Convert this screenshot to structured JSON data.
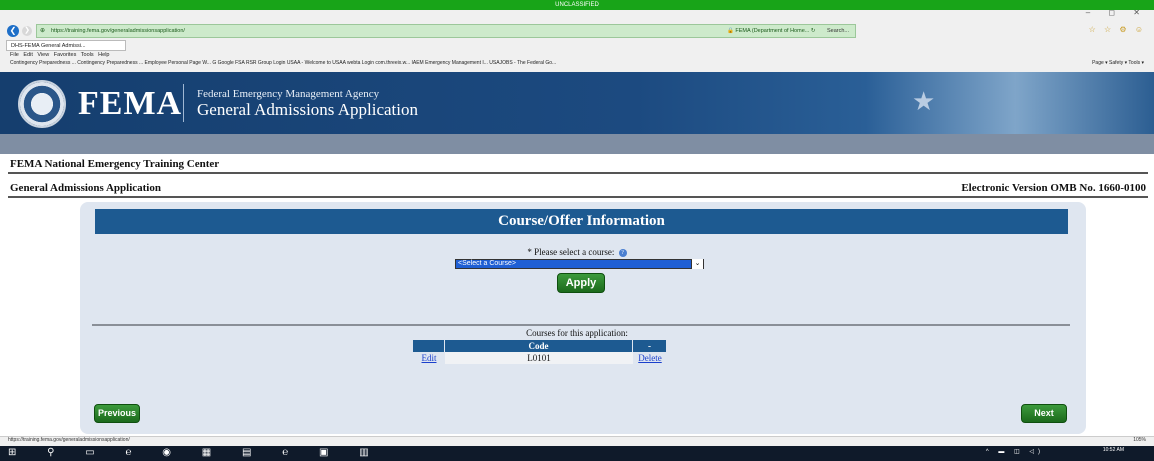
{
  "classification": "UNCLASSIFIED",
  "browser": {
    "window_controls": "– ◻ ✕",
    "back_glyph": "❮",
    "forward_glyph": "❯",
    "url": "https://training.fema.gov/generaladmissionsapplication/",
    "site_badge": "🔒 FEMA (Department of Home... ↻",
    "search_placeholder": "Search...",
    "right_icons": "☆ ☆ ⚙ ☺",
    "tab_title": "DHS-FEMA General Admissi...",
    "menu": "File  Edit  View  Favorites  Tools  Help",
    "favorites": "Contingency Preparedness ...   Contingency Preparedness ...   Employee Personal Page W...   G Google   FSA   RSR Group Login   USAA - Welcome to USAA   webta Login com.threeix.w...   IAEM   Emergency Management I...   USAJOBS - The Federal Go...",
    "favorites_right": "Page ▾  Safety ▾  Tools ▾",
    "status_url": "https://training.fema.gov/generaladmissionsapplication/",
    "zoom": "105%"
  },
  "header": {
    "logo_text": "FEMA",
    "agency": "Federal Emergency Management Agency",
    "app_title": "General Admissions Application",
    "star": "★"
  },
  "subheader": {
    "center_name": "FEMA National Emergency Training Center",
    "app_name": "General Admissions Application",
    "omb": "Electronic Version OMB No. 1660-0100"
  },
  "panel": {
    "title": "Course/Offer Information",
    "select_label": "* Please select a course:",
    "help_icon": "?",
    "select_value": "<Select a Course>",
    "select_arrow": "⌄",
    "apply_label": "Apply",
    "courses_caption": "Courses for this application:",
    "table": {
      "headers": [
        "",
        "Code",
        "-"
      ],
      "rows": [
        {
          "edit": "Edit",
          "code": "L0101",
          "delete": "Delete"
        }
      ]
    },
    "previous_label": "Previous",
    "next_label": "Next"
  },
  "taskbar": {
    "icons": "⊞ ⚲ ▭ ℮ ◉ ▦ ▤ ℮ ▣ ▥",
    "tray": "^ ▬ ◫ ◁)",
    "time": "10:52 AM"
  }
}
